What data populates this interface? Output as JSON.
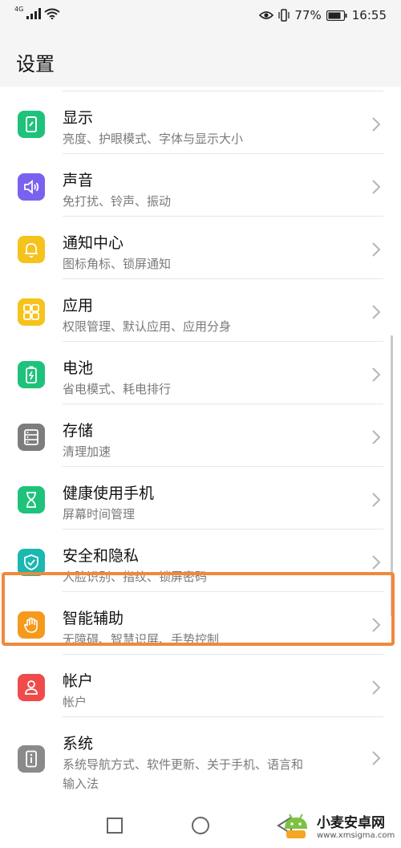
{
  "status_bar": {
    "network_label": "4G",
    "battery_percent": "77%",
    "time": "16:55"
  },
  "header": {
    "title": "设置"
  },
  "items": [
    {
      "title": "显示",
      "subtitle": "亮度、护眼模式、字体与显示大小",
      "color": "#1ec27a",
      "icon": "display-icon"
    },
    {
      "title": "声音",
      "subtitle": "免打扰、铃声、振动",
      "color": "#7b61f0",
      "icon": "speaker-icon"
    },
    {
      "title": "通知中心",
      "subtitle": "图标角标、锁屏通知",
      "color": "#f6c21c",
      "icon": "bell-icon"
    },
    {
      "title": "应用",
      "subtitle": "权限管理、默认应用、应用分身",
      "color": "#f6c21c",
      "icon": "apps-grid-icon"
    },
    {
      "title": "电池",
      "subtitle": "省电模式、耗电排行",
      "color": "#1ec27a",
      "icon": "battery-icon"
    },
    {
      "title": "存储",
      "subtitle": "清理加速",
      "color": "#7d7d7d",
      "icon": "storage-icon"
    },
    {
      "title": "健康使用手机",
      "subtitle": "屏幕时间管理",
      "color": "#1ec27a",
      "icon": "hourglass-icon"
    },
    {
      "title": "安全和隐私",
      "subtitle": "人脸识别、指纹、锁屏密码",
      "color": "#1ab8b0",
      "icon": "shield-icon"
    },
    {
      "title": "智能辅助",
      "subtitle": "无障碍、智慧识屏、手势控制",
      "color": "#f59a1c",
      "icon": "hand-icon"
    },
    {
      "title": "帐户",
      "subtitle": "帐户",
      "color": "#f04b4b",
      "icon": "user-icon"
    },
    {
      "title": "系统",
      "subtitle": "系统导航方式、软件更新、关于手机、语言和",
      "subtitle2": "输入法",
      "color": "#8a8a8a",
      "icon": "phone-info-icon"
    }
  ],
  "highlight_color": "#f0893b",
  "watermark": {
    "title": "小麦安卓网",
    "url": "www.xmsigma.com"
  }
}
